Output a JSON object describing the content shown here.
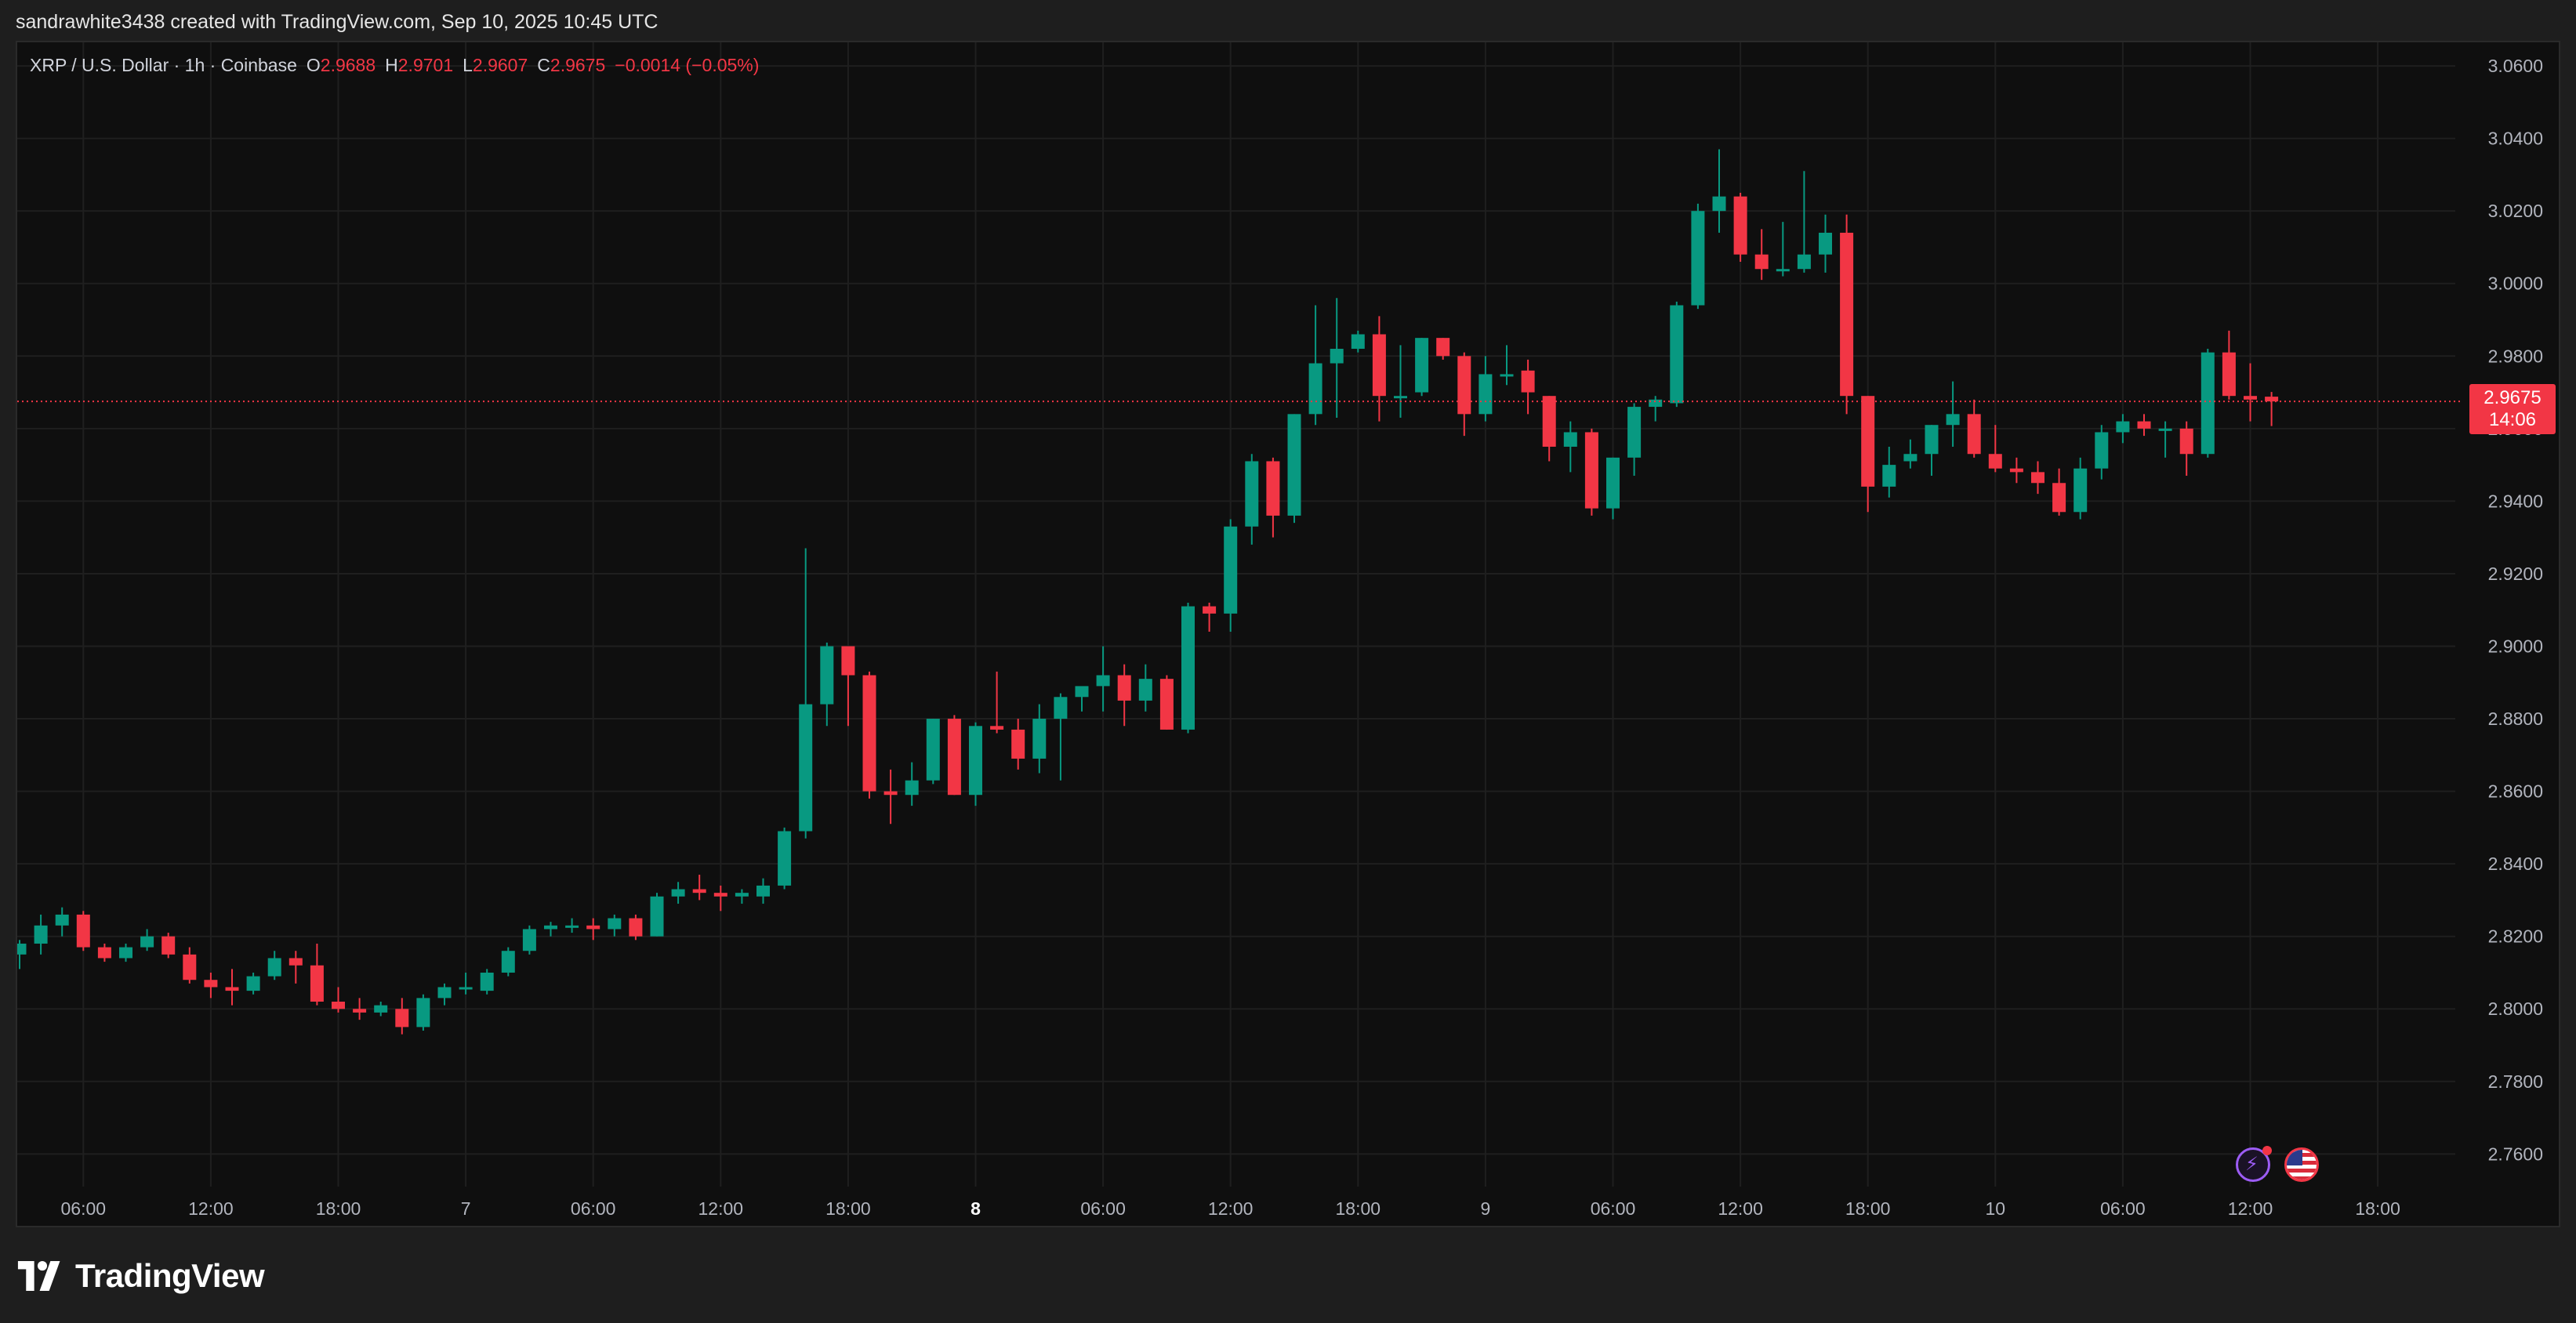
{
  "credit": "sandrawhite3438 created with TradingView.com, Sep 10, 2025 10:45 UTC",
  "legend": {
    "symbol": "XRP / U.S. Dollar · 1h · Coinbase",
    "o_label": "O",
    "o_value": "2.9688",
    "h_label": "H",
    "h_value": "2.9701",
    "l_label": "L",
    "l_value": "2.9607",
    "c_label": "C",
    "c_value": "2.9675",
    "change": "−0.0014 (−0.05%)"
  },
  "price_tag": {
    "price": "2.9675",
    "countdown": "14:06"
  },
  "brand": {
    "name": "TradingView"
  },
  "colors": {
    "up": "#089981",
    "down": "#f23645",
    "background": "#0f0f0f",
    "grid": "#1f1f1f",
    "axis_text": "#b2b5be",
    "page": "#1e1e1e"
  },
  "icons": {
    "events": "lightning-icon",
    "country": "us-flag-icon",
    "logo": "tradingview-logo-icon"
  },
  "chart_data": {
    "type": "candlestick",
    "title": "",
    "symbol": "XRP / U.S. Dollar",
    "interval": "1h",
    "exchange": "Coinbase",
    "ylim": [
      2.751,
      3.0665
    ],
    "y_ticks": [
      "3.0600",
      "3.0400",
      "3.0200",
      "3.0000",
      "2.9800",
      "2.9600",
      "2.9400",
      "2.9200",
      "2.9000",
      "2.8800",
      "2.8600",
      "2.8400",
      "2.8200",
      "2.8000",
      "2.7800",
      "2.7600"
    ],
    "x_ticks": [
      {
        "label": "06:00",
        "index": 3
      },
      {
        "label": "12:00",
        "index": 9
      },
      {
        "label": "18:00",
        "index": 15
      },
      {
        "label": "7",
        "index": 21,
        "bold": false
      },
      {
        "label": "06:00",
        "index": 27
      },
      {
        "label": "12:00",
        "index": 33
      },
      {
        "label": "18:00",
        "index": 39
      },
      {
        "label": "8",
        "index": 45,
        "bold": true
      },
      {
        "label": "06:00",
        "index": 51
      },
      {
        "label": "12:00",
        "index": 57
      },
      {
        "label": "18:00",
        "index": 63
      },
      {
        "label": "9",
        "index": 69,
        "bold": false
      },
      {
        "label": "06:00",
        "index": 75
      },
      {
        "label": "12:00",
        "index": 81
      },
      {
        "label": "18:00",
        "index": 87
      },
      {
        "label": "10",
        "index": 93,
        "bold": false
      },
      {
        "label": "06:00",
        "index": 99
      },
      {
        "label": "12:00",
        "index": 105
      },
      {
        "label": "18:00",
        "index": 111
      }
    ],
    "last_price": 2.9675,
    "candles": [
      {
        "o": 2.815,
        "h": 2.819,
        "l": 2.811,
        "c": 2.818
      },
      {
        "o": 2.818,
        "h": 2.826,
        "l": 2.815,
        "c": 2.823
      },
      {
        "o": 2.823,
        "h": 2.828,
        "l": 2.82,
        "c": 2.826
      },
      {
        "o": 2.826,
        "h": 2.827,
        "l": 2.816,
        "c": 2.817
      },
      {
        "o": 2.817,
        "h": 2.818,
        "l": 2.813,
        "c": 2.814
      },
      {
        "o": 2.814,
        "h": 2.818,
        "l": 2.813,
        "c": 2.817
      },
      {
        "o": 2.817,
        "h": 2.822,
        "l": 2.816,
        "c": 2.82
      },
      {
        "o": 2.82,
        "h": 2.821,
        "l": 2.814,
        "c": 2.815
      },
      {
        "o": 2.815,
        "h": 2.817,
        "l": 2.807,
        "c": 2.808
      },
      {
        "o": 2.808,
        "h": 2.81,
        "l": 2.803,
        "c": 2.806
      },
      {
        "o": 2.806,
        "h": 2.811,
        "l": 2.801,
        "c": 2.805
      },
      {
        "o": 2.805,
        "h": 2.81,
        "l": 2.804,
        "c": 2.809
      },
      {
        "o": 2.809,
        "h": 2.816,
        "l": 2.808,
        "c": 2.814
      },
      {
        "o": 2.814,
        "h": 2.816,
        "l": 2.807,
        "c": 2.812
      },
      {
        "o": 2.812,
        "h": 2.818,
        "l": 2.801,
        "c": 2.802
      },
      {
        "o": 2.802,
        "h": 2.806,
        "l": 2.799,
        "c": 2.8
      },
      {
        "o": 2.8,
        "h": 2.803,
        "l": 2.797,
        "c": 2.799
      },
      {
        "o": 2.799,
        "h": 2.802,
        "l": 2.798,
        "c": 2.801
      },
      {
        "o": 2.8,
        "h": 2.803,
        "l": 2.793,
        "c": 2.795
      },
      {
        "o": 2.795,
        "h": 2.804,
        "l": 2.794,
        "c": 2.803
      },
      {
        "o": 2.803,
        "h": 2.807,
        "l": 2.801,
        "c": 2.806
      },
      {
        "o": 2.806,
        "h": 2.81,
        "l": 2.804,
        "c": 2.806
      },
      {
        "o": 2.805,
        "h": 2.811,
        "l": 2.804,
        "c": 2.81
      },
      {
        "o": 2.81,
        "h": 2.817,
        "l": 2.809,
        "c": 2.816
      },
      {
        "o": 2.816,
        "h": 2.823,
        "l": 2.815,
        "c": 2.822
      },
      {
        "o": 2.822,
        "h": 2.824,
        "l": 2.82,
        "c": 2.823
      },
      {
        "o": 2.823,
        "h": 2.825,
        "l": 2.821,
        "c": 2.823
      },
      {
        "o": 2.823,
        "h": 2.825,
        "l": 2.819,
        "c": 2.822
      },
      {
        "o": 2.822,
        "h": 2.826,
        "l": 2.82,
        "c": 2.825
      },
      {
        "o": 2.825,
        "h": 2.826,
        "l": 2.819,
        "c": 2.82
      },
      {
        "o": 2.82,
        "h": 2.832,
        "l": 2.82,
        "c": 2.831
      },
      {
        "o": 2.831,
        "h": 2.835,
        "l": 2.829,
        "c": 2.833
      },
      {
        "o": 2.833,
        "h": 2.837,
        "l": 2.83,
        "c": 2.832
      },
      {
        "o": 2.832,
        "h": 2.834,
        "l": 2.827,
        "c": 2.831
      },
      {
        "o": 2.831,
        "h": 2.833,
        "l": 2.829,
        "c": 2.832
      },
      {
        "o": 2.831,
        "h": 2.836,
        "l": 2.829,
        "c": 2.834
      },
      {
        "o": 2.834,
        "h": 2.85,
        "l": 2.833,
        "c": 2.849
      },
      {
        "o": 2.849,
        "h": 2.927,
        "l": 2.847,
        "c": 2.884
      },
      {
        "o": 2.884,
        "h": 2.901,
        "l": 2.878,
        "c": 2.9
      },
      {
        "o": 2.9,
        "h": 2.9,
        "l": 2.878,
        "c": 2.892
      },
      {
        "o": 2.892,
        "h": 2.893,
        "l": 2.858,
        "c": 2.86
      },
      {
        "o": 2.86,
        "h": 2.866,
        "l": 2.851,
        "c": 2.859
      },
      {
        "o": 2.859,
        "h": 2.868,
        "l": 2.856,
        "c": 2.863
      },
      {
        "o": 2.863,
        "h": 2.88,
        "l": 2.862,
        "c": 2.88
      },
      {
        "o": 2.88,
        "h": 2.881,
        "l": 2.859,
        "c": 2.859
      },
      {
        "o": 2.859,
        "h": 2.879,
        "l": 2.856,
        "c": 2.878
      },
      {
        "o": 2.878,
        "h": 2.893,
        "l": 2.876,
        "c": 2.877
      },
      {
        "o": 2.877,
        "h": 2.88,
        "l": 2.866,
        "c": 2.869
      },
      {
        "o": 2.869,
        "h": 2.884,
        "l": 2.865,
        "c": 2.88
      },
      {
        "o": 2.88,
        "h": 2.887,
        "l": 2.863,
        "c": 2.886
      },
      {
        "o": 2.886,
        "h": 2.888,
        "l": 2.882,
        "c": 2.889
      },
      {
        "o": 2.889,
        "h": 2.9,
        "l": 2.882,
        "c": 2.892
      },
      {
        "o": 2.892,
        "h": 2.895,
        "l": 2.878,
        "c": 2.885
      },
      {
        "o": 2.885,
        "h": 2.895,
        "l": 2.882,
        "c": 2.891
      },
      {
        "o": 2.891,
        "h": 2.892,
        "l": 2.877,
        "c": 2.877
      },
      {
        "o": 2.877,
        "h": 2.912,
        "l": 2.876,
        "c": 2.911
      },
      {
        "o": 2.911,
        "h": 2.912,
        "l": 2.904,
        "c": 2.909
      },
      {
        "o": 2.909,
        "h": 2.935,
        "l": 2.904,
        "c": 2.933
      },
      {
        "o": 2.933,
        "h": 2.953,
        "l": 2.928,
        "c": 2.951
      },
      {
        "o": 2.951,
        "h": 2.952,
        "l": 2.93,
        "c": 2.936
      },
      {
        "o": 2.936,
        "h": 2.964,
        "l": 2.934,
        "c": 2.964
      },
      {
        "o": 2.964,
        "h": 2.994,
        "l": 2.961,
        "c": 2.978
      },
      {
        "o": 2.978,
        "h": 2.996,
        "l": 2.963,
        "c": 2.982
      },
      {
        "o": 2.982,
        "h": 2.987,
        "l": 2.981,
        "c": 2.986
      },
      {
        "o": 2.986,
        "h": 2.991,
        "l": 2.962,
        "c": 2.969
      },
      {
        "o": 2.969,
        "h": 2.983,
        "l": 2.963,
        "c": 2.969
      },
      {
        "o": 2.97,
        "h": 2.985,
        "l": 2.969,
        "c": 2.985
      },
      {
        "o": 2.985,
        "h": 2.985,
        "l": 2.979,
        "c": 2.98
      },
      {
        "o": 2.98,
        "h": 2.981,
        "l": 2.958,
        "c": 2.964
      },
      {
        "o": 2.964,
        "h": 2.98,
        "l": 2.962,
        "c": 2.975
      },
      {
        "o": 2.975,
        "h": 2.983,
        "l": 2.972,
        "c": 2.975
      },
      {
        "o": 2.976,
        "h": 2.979,
        "l": 2.964,
        "c": 2.97
      },
      {
        "o": 2.969,
        "h": 2.969,
        "l": 2.951,
        "c": 2.955
      },
      {
        "o": 2.955,
        "h": 2.962,
        "l": 2.948,
        "c": 2.959
      },
      {
        "o": 2.959,
        "h": 2.96,
        "l": 2.936,
        "c": 2.938
      },
      {
        "o": 2.938,
        "h": 2.952,
        "l": 2.935,
        "c": 2.952
      },
      {
        "o": 2.952,
        "h": 2.967,
        "l": 2.947,
        "c": 2.966
      },
      {
        "o": 2.966,
        "h": 2.969,
        "l": 2.962,
        "c": 2.968
      },
      {
        "o": 2.967,
        "h": 2.995,
        "l": 2.966,
        "c": 2.994
      },
      {
        "o": 2.994,
        "h": 3.022,
        "l": 2.993,
        "c": 3.02
      },
      {
        "o": 3.02,
        "h": 3.037,
        "l": 3.014,
        "c": 3.024
      },
      {
        "o": 3.024,
        "h": 3.025,
        "l": 3.006,
        "c": 3.008
      },
      {
        "o": 3.008,
        "h": 3.015,
        "l": 3.001,
        "c": 3.004
      },
      {
        "o": 3.004,
        "h": 3.017,
        "l": 3.002,
        "c": 3.004
      },
      {
        "o": 3.004,
        "h": 3.031,
        "l": 3.003,
        "c": 3.008
      },
      {
        "o": 3.008,
        "h": 3.019,
        "l": 3.003,
        "c": 3.014
      },
      {
        "o": 3.014,
        "h": 3.019,
        "l": 2.964,
        "c": 2.969
      },
      {
        "o": 2.969,
        "h": 2.969,
        "l": 2.937,
        "c": 2.944
      },
      {
        "o": 2.944,
        "h": 2.955,
        "l": 2.941,
        "c": 2.95
      },
      {
        "o": 2.951,
        "h": 2.957,
        "l": 2.949,
        "c": 2.953
      },
      {
        "o": 2.953,
        "h": 2.961,
        "l": 2.947,
        "c": 2.961
      },
      {
        "o": 2.961,
        "h": 2.973,
        "l": 2.955,
        "c": 2.964
      },
      {
        "o": 2.964,
        "h": 2.968,
        "l": 2.952,
        "c": 2.953
      },
      {
        "o": 2.953,
        "h": 2.961,
        "l": 2.948,
        "c": 2.949
      },
      {
        "o": 2.949,
        "h": 2.952,
        "l": 2.945,
        "c": 2.948
      },
      {
        "o": 2.948,
        "h": 2.951,
        "l": 2.942,
        "c": 2.945
      },
      {
        "o": 2.945,
        "h": 2.949,
        "l": 2.936,
        "c": 2.937
      },
      {
        "o": 2.937,
        "h": 2.952,
        "l": 2.935,
        "c": 2.949
      },
      {
        "o": 2.949,
        "h": 2.961,
        "l": 2.946,
        "c": 2.959
      },
      {
        "o": 2.959,
        "h": 2.964,
        "l": 2.956,
        "c": 2.962
      },
      {
        "o": 2.962,
        "h": 2.964,
        "l": 2.958,
        "c": 2.96
      },
      {
        "o": 2.96,
        "h": 2.962,
        "l": 2.952,
        "c": 2.96
      },
      {
        "o": 2.96,
        "h": 2.962,
        "l": 2.947,
        "c": 2.953
      },
      {
        "o": 2.953,
        "h": 2.982,
        "l": 2.952,
        "c": 2.981
      },
      {
        "o": 2.981,
        "h": 2.987,
        "l": 2.968,
        "c": 2.969
      },
      {
        "o": 2.969,
        "h": 2.978,
        "l": 2.962,
        "c": 2.968
      },
      {
        "o": 2.9688,
        "h": 2.9701,
        "l": 2.9607,
        "c": 2.9675
      }
    ]
  }
}
